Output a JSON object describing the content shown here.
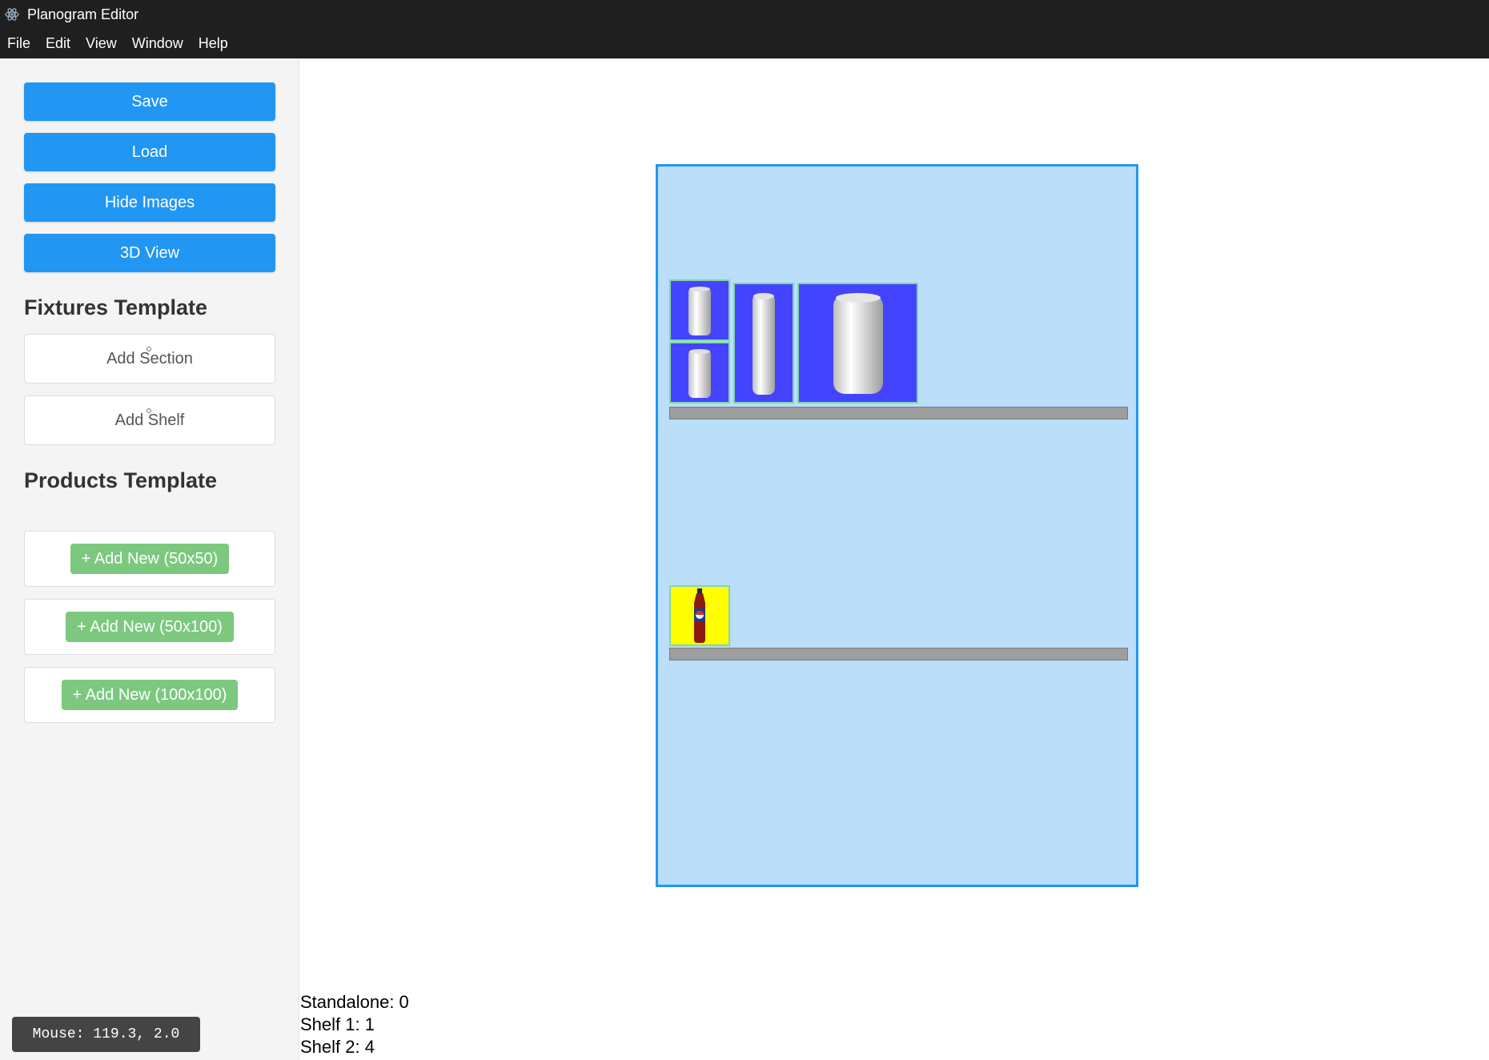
{
  "window": {
    "title": "Planogram Editor",
    "icon": "electron-atom-icon"
  },
  "menu": [
    "File",
    "Edit",
    "View",
    "Window",
    "Help"
  ],
  "sidebar": {
    "buttons": {
      "save": "Save",
      "load": "Load",
      "hide_images": "Hide Images",
      "view_3d": "3D View"
    },
    "fixtures_title": "Fixtures Template",
    "fixtures": {
      "add_section": "Add Section",
      "add_shelf": "Add Shelf"
    },
    "products_title": "Products Template",
    "products": {
      "add_50x50": "+ Add New (50x50)",
      "add_50x100": "+ Add New (50x100)",
      "add_100x100": "+ Add New (100x100)"
    }
  },
  "status": {
    "mouse": "Mouse: 119.3, 2.0"
  },
  "counts": {
    "standalone": "Standalone: 0",
    "shelf1": "Shelf 1: 1",
    "shelf2": "Shelf 2: 4"
  },
  "colors": {
    "accent_blue": "#2196f3",
    "section_fill": "#bbdefb",
    "product_blue": "#4444ff",
    "product_yellow": "#ffff00",
    "shelf_gray": "#9e9e9e",
    "add_green": "#7cc87f"
  },
  "products_on_canvas": [
    {
      "image": "small-can-icon",
      "shelf": "top"
    },
    {
      "image": "small-can-icon",
      "shelf": "top"
    },
    {
      "image": "tall-can-icon",
      "shelf": "top"
    },
    {
      "image": "large-can-icon",
      "shelf": "top"
    },
    {
      "image": "soda-bottle-icon",
      "shelf": "bottom"
    }
  ]
}
